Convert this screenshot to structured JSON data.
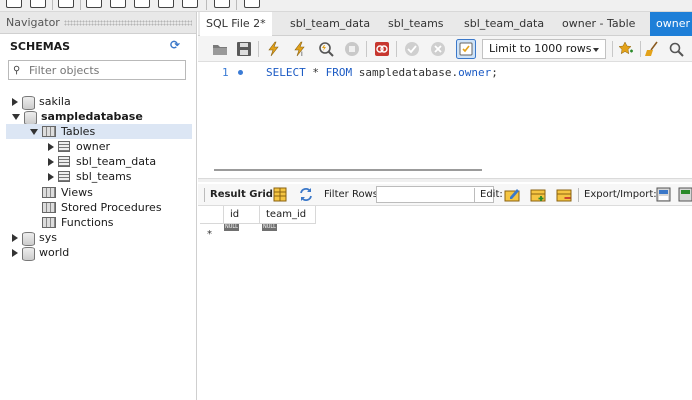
{
  "navigator": {
    "title": "Navigator",
    "schemas_label": "SCHEMAS",
    "filter_placeholder": "Filter objects",
    "tree": [
      {
        "label": "sakila"
      },
      {
        "label": "sampledatabase"
      },
      {
        "label": "Tables"
      },
      {
        "label": "owner"
      },
      {
        "label": "sbl_team_data"
      },
      {
        "label": "sbl_teams"
      },
      {
        "label": "Views"
      },
      {
        "label": "Stored Procedures"
      },
      {
        "label": "Functions"
      },
      {
        "label": "sys"
      },
      {
        "label": "world"
      }
    ]
  },
  "tabs": [
    {
      "label": "SQL File 2*"
    },
    {
      "label": "sbl_team_data"
    },
    {
      "label": "sbl_teams"
    },
    {
      "label": "sbl_team_data"
    },
    {
      "label": "owner - Table"
    },
    {
      "label": "owner"
    }
  ],
  "query_toolbar": {
    "limit_label": "Limit to 1000 rows"
  },
  "editor": {
    "line_number": "1",
    "kw_select": "SELECT",
    "star": " * ",
    "kw_from": "FROM",
    "table_ref": " sampledatabase.",
    "table_name": "owner",
    "semicolon": ";"
  },
  "result_toolbar": {
    "result_grid": "Result Grid",
    "filter_rows": "Filter Rows:",
    "edit": "Edit:",
    "export_import": "Export/Import:"
  },
  "grid": {
    "columns": [
      "id",
      "team_id"
    ],
    "null_label": "NULL",
    "new_row_marker": "*"
  },
  "colors": {
    "accent": "#1e7fd8",
    "keyword": "#1c5bc4"
  }
}
